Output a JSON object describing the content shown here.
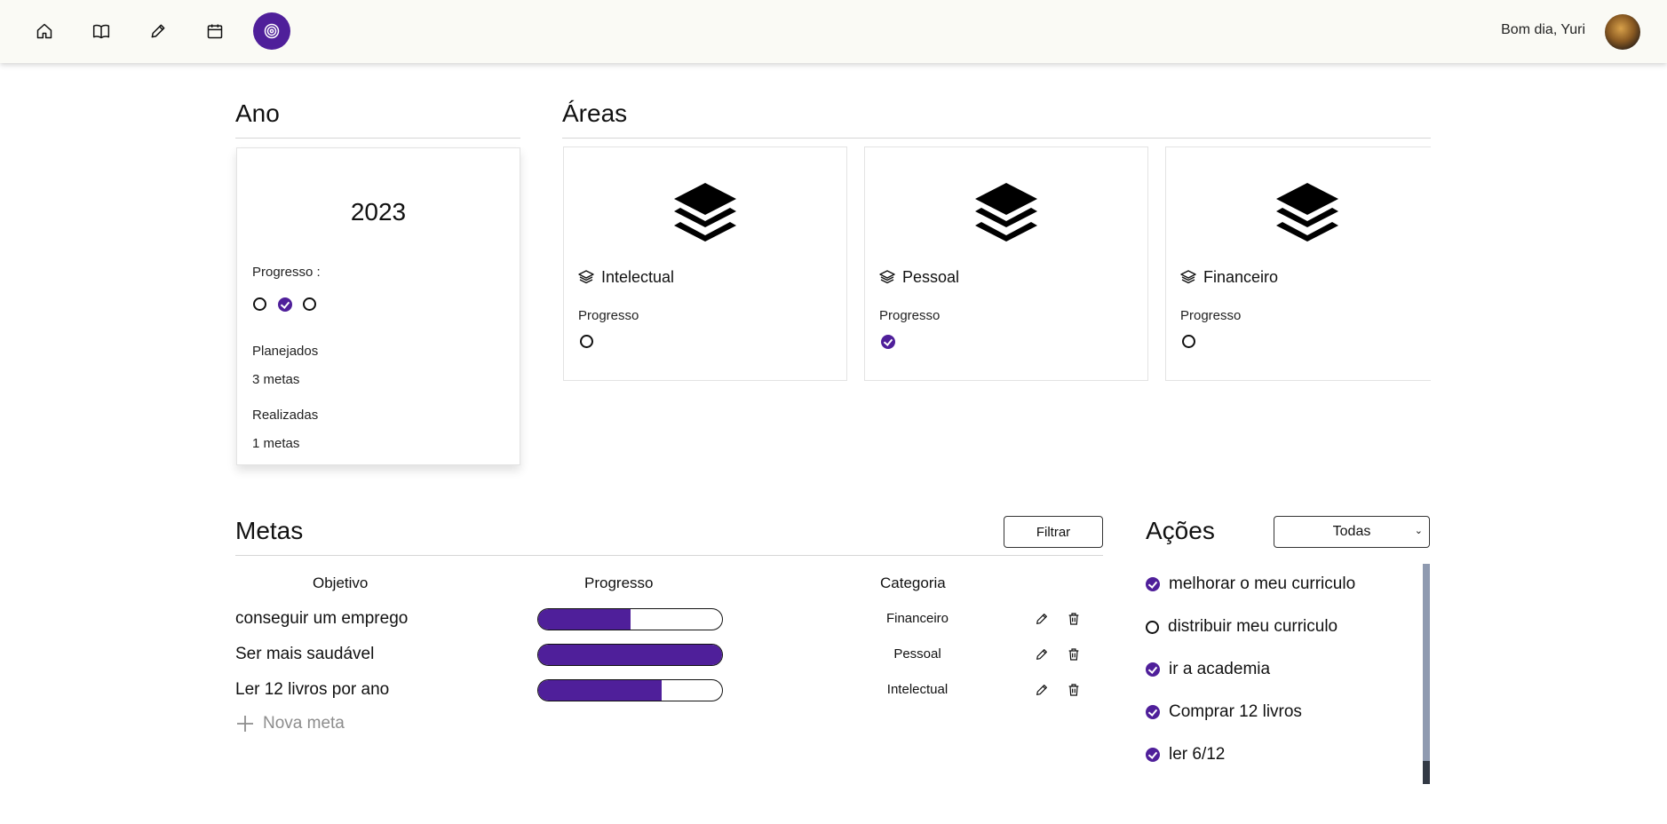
{
  "header": {
    "greeting": "Bom dia, Yuri",
    "nav": [
      {
        "icon": "home-icon"
      },
      {
        "icon": "book-icon"
      },
      {
        "icon": "pencil-icon"
      },
      {
        "icon": "calendar-icon"
      },
      {
        "icon": "target-icon",
        "active": true
      }
    ]
  },
  "ano": {
    "title": "Ano",
    "year": "2023",
    "progress_label": "Progresso :",
    "progress": [
      false,
      true,
      false
    ],
    "planned_label": "Planejados",
    "planned_value": "3 metas",
    "done_label": "Realizadas",
    "done_value": "1 metas"
  },
  "areas": {
    "title": "Áreas",
    "items": [
      {
        "name": "Intelectual",
        "progress_label": "Progresso",
        "done": false
      },
      {
        "name": "Pessoal",
        "progress_label": "Progresso",
        "done": true
      },
      {
        "name": "Financeiro",
        "progress_label": "Progresso",
        "done": false
      }
    ]
  },
  "metas": {
    "title": "Metas",
    "filter_label": "Filtrar",
    "columns": [
      "Objetivo",
      "Progresso",
      "Categoria"
    ],
    "rows": [
      {
        "objective": "conseguir um emprego",
        "progress": 0.5,
        "category": "Financeiro"
      },
      {
        "objective": "Ser mais saudável",
        "progress": 1.0,
        "category": "Pessoal"
      },
      {
        "objective": "Ler 12 livros por ano",
        "progress": 0.67,
        "category": "Intelectual"
      }
    ],
    "new_label": "Nova meta"
  },
  "acoes": {
    "title": "Ações",
    "filter_value": "Todas",
    "items": [
      {
        "label": "melhorar o meu curriculo",
        "done": true
      },
      {
        "label": "distribuir meu curriculo",
        "done": false
      },
      {
        "label": "ir a academia",
        "done": true
      },
      {
        "label": "Comprar 12 livros",
        "done": true
      },
      {
        "label": "ler 6/12",
        "done": true
      }
    ]
  },
  "colors": {
    "accent": "#4f1f9a",
    "topbar": "#fafaf5"
  }
}
